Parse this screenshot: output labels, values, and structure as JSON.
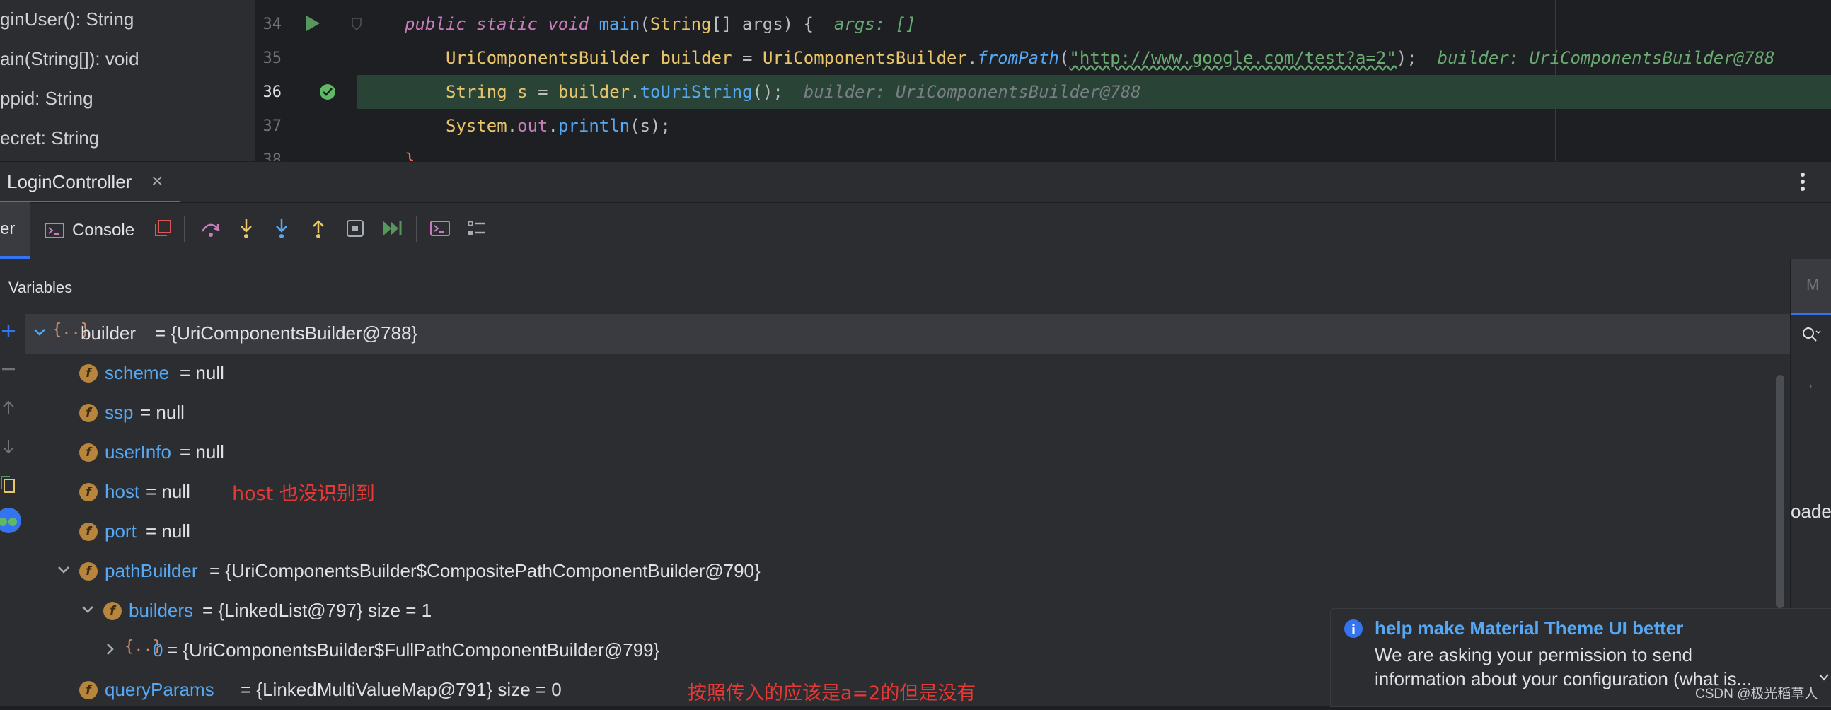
{
  "structure": {
    "items": [
      "ginUser(): String",
      "ain(String[]): void",
      "ppid: String",
      "ecret: String"
    ]
  },
  "editor": {
    "line_numbers": [
      "34",
      "35",
      "36",
      "37",
      "38"
    ],
    "line34": {
      "kw1": "public",
      "kw2": "static",
      "kw3": "void",
      "method": "main",
      "open": "(",
      "type": "String",
      "rest": "[] args) {",
      "hint": "args: []"
    },
    "line35": {
      "type": "UriComponentsBuilder",
      "var": "builder",
      "eq": "=",
      "cls": "UriComponentsBuilder",
      "dot": ".",
      "method": "fromPath",
      "open": "(",
      "str": "\"http://www.google.com/test?a=2\"",
      "close": ");",
      "hint": "builder: UriComponentsBuilder@788"
    },
    "line36": {
      "type": "String",
      "var": "s",
      "eq": "=",
      "obj": "builder",
      "dot": ".",
      "method": "toUriString",
      "close": "();",
      "hint": "builder: UriComponentsBuilder@788"
    },
    "line37": {
      "cls": "System",
      "dot1": ".",
      "field": "out",
      "dot2": ".",
      "method": "println",
      "args": "(s);"
    },
    "line38": {
      "text": "}"
    }
  },
  "debug_tab": {
    "label": "LoginController",
    "close": "×"
  },
  "toolbar": {
    "debugger_label": "er",
    "console_label": "Console"
  },
  "variables_header": "Variables",
  "variables": {
    "builder": {
      "name": "builder",
      "value": "= {UriComponentsBuilder@788}"
    },
    "scheme": {
      "name": "scheme",
      "value": "= null"
    },
    "ssp": {
      "name": "ssp",
      "value": "= null"
    },
    "userInfo": {
      "name": "userInfo",
      "value": "= null"
    },
    "host": {
      "name": "host",
      "value": "= null"
    },
    "port": {
      "name": "port",
      "value": "= null"
    },
    "pathBuilder": {
      "name": "pathBuilder",
      "value": "= {UriComponentsBuilder$CompositePathComponentBuilder@790}"
    },
    "builders": {
      "name": "builders",
      "value": "= {LinkedList@797}  size = 1"
    },
    "item0": {
      "name": "0",
      "value": "= {UriComponentsBuilder$FullPathComponentBuilder@799}"
    },
    "queryParams": {
      "name": "queryParams",
      "value": "= {LinkedMultiValueMap@791}  size = 0"
    }
  },
  "annotations": {
    "host_note": "host 也没识别到",
    "query_note": "按照传入的应该是a=2的但是没有"
  },
  "right_panel": {
    "top_text": "M",
    "bottom_text": "oadec"
  },
  "notification": {
    "title": "help make Material Theme UI better",
    "body_line1": "We are asking your permission to send",
    "body_line2": "information about your configuration (what is..."
  },
  "watermark": "CSDN @极光稻草人",
  "colors": {
    "accent": "#3574f0",
    "highlight_line": "#294436",
    "annotation": "#e53935"
  }
}
